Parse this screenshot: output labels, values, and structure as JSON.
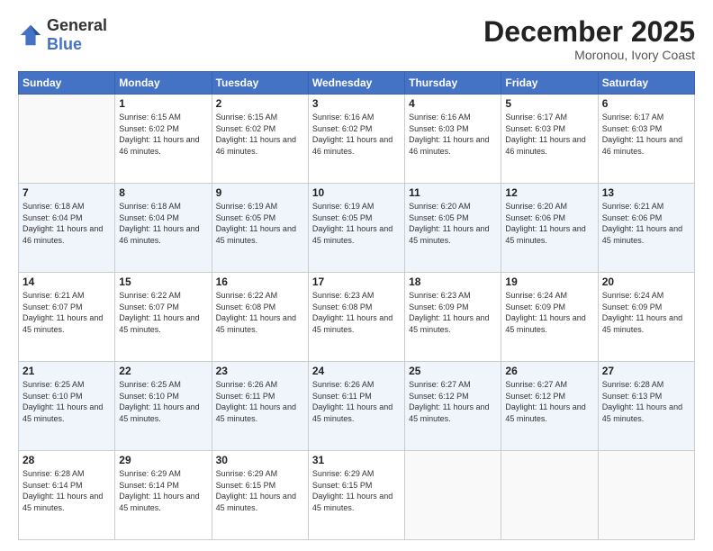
{
  "logo": {
    "general": "General",
    "blue": "Blue"
  },
  "header": {
    "month": "December 2025",
    "location": "Moronou, Ivory Coast"
  },
  "days_of_week": [
    "Sunday",
    "Monday",
    "Tuesday",
    "Wednesday",
    "Thursday",
    "Friday",
    "Saturday"
  ],
  "weeks": [
    [
      {
        "day": "",
        "sunrise": "",
        "sunset": "",
        "daylight": ""
      },
      {
        "day": "1",
        "sunrise": "Sunrise: 6:15 AM",
        "sunset": "Sunset: 6:02 PM",
        "daylight": "Daylight: 11 hours and 46 minutes."
      },
      {
        "day": "2",
        "sunrise": "Sunrise: 6:15 AM",
        "sunset": "Sunset: 6:02 PM",
        "daylight": "Daylight: 11 hours and 46 minutes."
      },
      {
        "day": "3",
        "sunrise": "Sunrise: 6:16 AM",
        "sunset": "Sunset: 6:02 PM",
        "daylight": "Daylight: 11 hours and 46 minutes."
      },
      {
        "day": "4",
        "sunrise": "Sunrise: 6:16 AM",
        "sunset": "Sunset: 6:03 PM",
        "daylight": "Daylight: 11 hours and 46 minutes."
      },
      {
        "day": "5",
        "sunrise": "Sunrise: 6:17 AM",
        "sunset": "Sunset: 6:03 PM",
        "daylight": "Daylight: 11 hours and 46 minutes."
      },
      {
        "day": "6",
        "sunrise": "Sunrise: 6:17 AM",
        "sunset": "Sunset: 6:03 PM",
        "daylight": "Daylight: 11 hours and 46 minutes."
      }
    ],
    [
      {
        "day": "7",
        "sunrise": "Sunrise: 6:18 AM",
        "sunset": "Sunset: 6:04 PM",
        "daylight": "Daylight: 11 hours and 46 minutes."
      },
      {
        "day": "8",
        "sunrise": "Sunrise: 6:18 AM",
        "sunset": "Sunset: 6:04 PM",
        "daylight": "Daylight: 11 hours and 46 minutes."
      },
      {
        "day": "9",
        "sunrise": "Sunrise: 6:19 AM",
        "sunset": "Sunset: 6:05 PM",
        "daylight": "Daylight: 11 hours and 45 minutes."
      },
      {
        "day": "10",
        "sunrise": "Sunrise: 6:19 AM",
        "sunset": "Sunset: 6:05 PM",
        "daylight": "Daylight: 11 hours and 45 minutes."
      },
      {
        "day": "11",
        "sunrise": "Sunrise: 6:20 AM",
        "sunset": "Sunset: 6:05 PM",
        "daylight": "Daylight: 11 hours and 45 minutes."
      },
      {
        "day": "12",
        "sunrise": "Sunrise: 6:20 AM",
        "sunset": "Sunset: 6:06 PM",
        "daylight": "Daylight: 11 hours and 45 minutes."
      },
      {
        "day": "13",
        "sunrise": "Sunrise: 6:21 AM",
        "sunset": "Sunset: 6:06 PM",
        "daylight": "Daylight: 11 hours and 45 minutes."
      }
    ],
    [
      {
        "day": "14",
        "sunrise": "Sunrise: 6:21 AM",
        "sunset": "Sunset: 6:07 PM",
        "daylight": "Daylight: 11 hours and 45 minutes."
      },
      {
        "day": "15",
        "sunrise": "Sunrise: 6:22 AM",
        "sunset": "Sunset: 6:07 PM",
        "daylight": "Daylight: 11 hours and 45 minutes."
      },
      {
        "day": "16",
        "sunrise": "Sunrise: 6:22 AM",
        "sunset": "Sunset: 6:08 PM",
        "daylight": "Daylight: 11 hours and 45 minutes."
      },
      {
        "day": "17",
        "sunrise": "Sunrise: 6:23 AM",
        "sunset": "Sunset: 6:08 PM",
        "daylight": "Daylight: 11 hours and 45 minutes."
      },
      {
        "day": "18",
        "sunrise": "Sunrise: 6:23 AM",
        "sunset": "Sunset: 6:09 PM",
        "daylight": "Daylight: 11 hours and 45 minutes."
      },
      {
        "day": "19",
        "sunrise": "Sunrise: 6:24 AM",
        "sunset": "Sunset: 6:09 PM",
        "daylight": "Daylight: 11 hours and 45 minutes."
      },
      {
        "day": "20",
        "sunrise": "Sunrise: 6:24 AM",
        "sunset": "Sunset: 6:09 PM",
        "daylight": "Daylight: 11 hours and 45 minutes."
      }
    ],
    [
      {
        "day": "21",
        "sunrise": "Sunrise: 6:25 AM",
        "sunset": "Sunset: 6:10 PM",
        "daylight": "Daylight: 11 hours and 45 minutes."
      },
      {
        "day": "22",
        "sunrise": "Sunrise: 6:25 AM",
        "sunset": "Sunset: 6:10 PM",
        "daylight": "Daylight: 11 hours and 45 minutes."
      },
      {
        "day": "23",
        "sunrise": "Sunrise: 6:26 AM",
        "sunset": "Sunset: 6:11 PM",
        "daylight": "Daylight: 11 hours and 45 minutes."
      },
      {
        "day": "24",
        "sunrise": "Sunrise: 6:26 AM",
        "sunset": "Sunset: 6:11 PM",
        "daylight": "Daylight: 11 hours and 45 minutes."
      },
      {
        "day": "25",
        "sunrise": "Sunrise: 6:27 AM",
        "sunset": "Sunset: 6:12 PM",
        "daylight": "Daylight: 11 hours and 45 minutes."
      },
      {
        "day": "26",
        "sunrise": "Sunrise: 6:27 AM",
        "sunset": "Sunset: 6:12 PM",
        "daylight": "Daylight: 11 hours and 45 minutes."
      },
      {
        "day": "27",
        "sunrise": "Sunrise: 6:28 AM",
        "sunset": "Sunset: 6:13 PM",
        "daylight": "Daylight: 11 hours and 45 minutes."
      }
    ],
    [
      {
        "day": "28",
        "sunrise": "Sunrise: 6:28 AM",
        "sunset": "Sunset: 6:14 PM",
        "daylight": "Daylight: 11 hours and 45 minutes."
      },
      {
        "day": "29",
        "sunrise": "Sunrise: 6:29 AM",
        "sunset": "Sunset: 6:14 PM",
        "daylight": "Daylight: 11 hours and 45 minutes."
      },
      {
        "day": "30",
        "sunrise": "Sunrise: 6:29 AM",
        "sunset": "Sunset: 6:15 PM",
        "daylight": "Daylight: 11 hours and 45 minutes."
      },
      {
        "day": "31",
        "sunrise": "Sunrise: 6:29 AM",
        "sunset": "Sunset: 6:15 PM",
        "daylight": "Daylight: 11 hours and 45 minutes."
      },
      {
        "day": "",
        "sunrise": "",
        "sunset": "",
        "daylight": ""
      },
      {
        "day": "",
        "sunrise": "",
        "sunset": "",
        "daylight": ""
      },
      {
        "day": "",
        "sunrise": "",
        "sunset": "",
        "daylight": ""
      }
    ]
  ]
}
